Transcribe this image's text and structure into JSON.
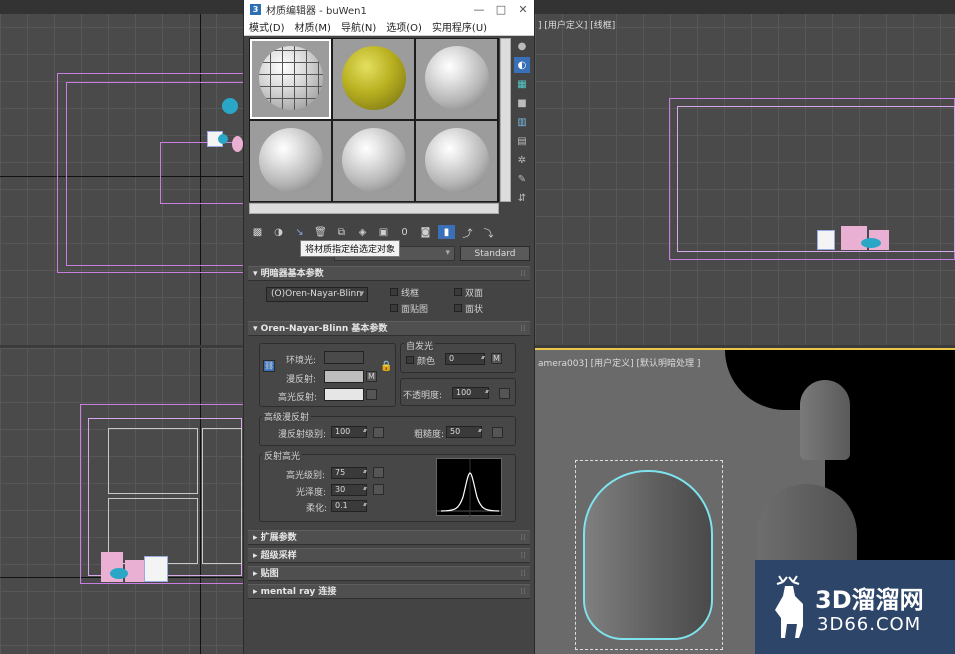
{
  "editor": {
    "title": "材质编辑器 - buWen1",
    "app_icon": "3",
    "window_buttons": [
      "—",
      "□",
      "✕"
    ],
    "menu": [
      "模式(D)",
      "材质(M)",
      "导航(N)",
      "选项(O)",
      "实用程序(U)"
    ],
    "tooltip": "将材质指定给选定对象",
    "standard_label": "Standard",
    "rollouts": {
      "shader_basic": "明暗器基本参数",
      "onb_basic": "Oren-Nayar-Blinn 基本参数",
      "extended": "扩展参数",
      "supersampling": "超级采样",
      "maps": "贴图",
      "mental_ray": "mental ray 连接"
    },
    "shader": {
      "dropdown": "(O)Oren-Nayar-Blinn",
      "wire": "线框",
      "two_sided": "双面",
      "face_map": "面贴图",
      "faceted": "面状"
    },
    "basic": {
      "ambient": "环境光:",
      "diffuse": "漫反射:",
      "specular": "高光反射:",
      "self_illum_title": "自发光",
      "color_label": "颜色",
      "self_illum_value": "0",
      "opacity_label": "不透明度:",
      "opacity_value": "100",
      "m_label": "M"
    },
    "advanced_diffuse": {
      "title": "高级漫反射",
      "diffuse_level_label": "漫反射级别:",
      "diffuse_level_value": "100",
      "roughness_label": "粗糙度:",
      "roughness_value": "50"
    },
    "specular_highlights": {
      "title": "反射高光",
      "spec_level_label": "高光级别:",
      "spec_level_value": "75",
      "glossiness_label": "光泽度:",
      "glossiness_value": "30",
      "soften_label": "柔化:",
      "soften_value": "0.1"
    }
  },
  "viewports": {
    "top_right_label": "] [用户定义] [线框]",
    "bottom_right_label": "amera003] [用户定义] [默认明暗处理 ]"
  },
  "watermark": {
    "brand": "3D溜溜网",
    "url": "3D66.COM"
  },
  "colors": {
    "background": "#3b3b3b",
    "viewport": "#4a4a4a",
    "selection": "#7fe3ee",
    "object_pink": "#c77ee0"
  }
}
